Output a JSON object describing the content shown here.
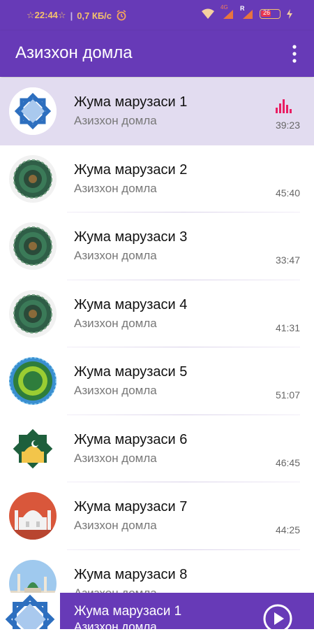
{
  "status": {
    "time": "☆22:44☆",
    "separator": "|",
    "speed": "0,7 КБ/с",
    "net_label": "4G",
    "roaming": "R",
    "battery": "26"
  },
  "appbar": {
    "title": "Азизхон домла"
  },
  "tracks": [
    {
      "title": "Жума марузаси 1",
      "subtitle": "Азизхон домла",
      "duration": "39:23",
      "thumb": "blue-star-logo",
      "active": true
    },
    {
      "title": "Жума марузаси 2",
      "subtitle": "Азизхон домла",
      "duration": "45:40",
      "thumb": "green-mandala"
    },
    {
      "title": "Жума марузаси 3",
      "subtitle": "Азизхон домла",
      "duration": "33:47",
      "thumb": "green-mandala"
    },
    {
      "title": "Жума марузаси 4",
      "subtitle": "Азизхон домла",
      "duration": "41:31",
      "thumb": "green-mandala"
    },
    {
      "title": "Жума марузаси 5",
      "subtitle": "Азизхон домла",
      "duration": "51:07",
      "thumb": "green-blue-ornament"
    },
    {
      "title": "Жума марузаси 6",
      "subtitle": "Азизхон домла",
      "duration": "46:45",
      "thumb": "mosque-star"
    },
    {
      "title": "Жума марузаси 7",
      "subtitle": "Азизхон домла",
      "duration": "44:25",
      "thumb": "mosque-red"
    },
    {
      "title": "Жума марузаси 8",
      "subtitle": "Азизхон домла",
      "duration": "",
      "thumb": "mosque-photo"
    }
  ],
  "player": {
    "title": "Жума марузаси 1",
    "subtitle": "Азизхон домла"
  },
  "colors": {
    "primary": "#673ab7",
    "active_row": "#e2dcf0",
    "eq": "#e91e63"
  }
}
